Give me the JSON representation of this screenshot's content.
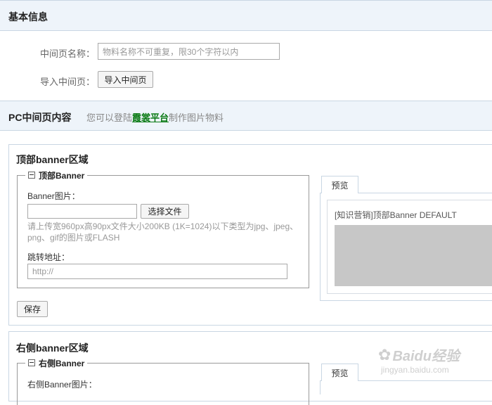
{
  "basic_info": {
    "title": "基本信息",
    "name_label": "中间页名称：",
    "name_placeholder": "物料名称不可重复，限30个字符以内",
    "import_label": "导入中间页：",
    "import_button": "导入中间页"
  },
  "pc_content": {
    "title": "PC中间页内容",
    "hint_prefix": "您可以登陆",
    "hint_link": "霞裳平台",
    "hint_suffix": "制作图片物料"
  },
  "top_banner": {
    "area_title": "顶部banner区域",
    "legend": "顶部Banner",
    "image_label": "Banner图片：",
    "choose_file": "选择文件",
    "upload_hint": "请上传宽960px高90px文件大小200KB (1K=1024)以下类型为jpg、jpeg、png、gif的图片或FLASH",
    "jump_label": "跳转地址：",
    "jump_placeholder": "http://",
    "save_button": "保存",
    "preview_tab": "预览",
    "preview_text": "[知识营销]顶部Banner DEFAULT"
  },
  "right_banner": {
    "area_title": "右侧banner区域",
    "legend": "右侧Banner",
    "image_label": "右侧Banner图片：",
    "preview_tab": "预览"
  },
  "watermark": {
    "brand": "Baidu经验",
    "url": "jingyan.baidu.com"
  }
}
